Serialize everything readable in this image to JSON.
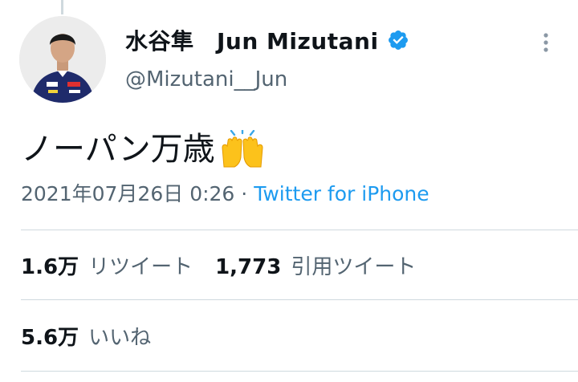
{
  "author": {
    "display_name": "水谷隼　Jun Mizutani",
    "handle": "@Mizutani__Jun",
    "verified": true,
    "avatar_icon": "profile-photo"
  },
  "tweet": {
    "text": "ノーパン万歳",
    "emoji": "raising-hands",
    "timestamp": "2021年07月26日 0:26",
    "separator": " · ",
    "source": "Twitter for iPhone"
  },
  "stats": {
    "retweets_value": "1.6万",
    "retweets_label": "リツイート",
    "quotes_value": "1,773",
    "quotes_label": "引用ツイート",
    "likes_value": "5.6万",
    "likes_label": "いいね"
  },
  "colors": {
    "link": "#1d9bf0",
    "secondary_text": "#536471",
    "divider": "#cfd9de",
    "verified": "#1d9bf0"
  }
}
